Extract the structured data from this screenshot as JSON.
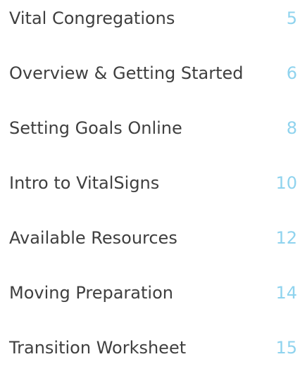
{
  "toc": {
    "entries": [
      {
        "title": "Vital Congregations",
        "page": "5"
      },
      {
        "title": "Overview & Getting Started",
        "page": "6"
      },
      {
        "title": "Setting Goals Online",
        "page": "8"
      },
      {
        "title": "Intro to VitalSigns",
        "page": "10"
      },
      {
        "title": "Available Resources",
        "page": "12"
      },
      {
        "title": "Moving Preparation",
        "page": "14"
      },
      {
        "title": "Transition Worksheet",
        "page": "15"
      }
    ]
  },
  "colors": {
    "title_text": "#3f3f3f",
    "page_number": "#8fd3ee",
    "background": "#ffffff"
  }
}
